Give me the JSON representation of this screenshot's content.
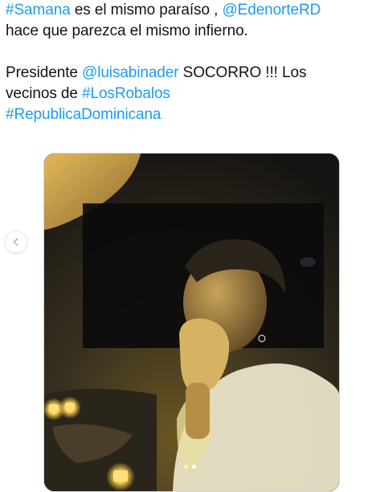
{
  "tweet": {
    "line1": {
      "hashtag": "#Samana",
      "text": " es el mismo paraíso , ",
      "mention": "@EdenorteRD"
    },
    "line2": "hace que parezca el mismo infierno.",
    "line3": {
      "text_before": "Presidente ",
      "mention": "@luisabinader",
      "text_after": " SOCORRO !!! Los"
    },
    "line4": {
      "text_before": "vecinos de ",
      "hashtag": "#LosRobalos"
    },
    "line5": {
      "hashtag": "#RepublicaDominicana"
    }
  },
  "media": {
    "icon": "photo",
    "carousel": {
      "prev_icon": "chevron-left-icon",
      "total": 2,
      "active_index": 2
    }
  },
  "colors": {
    "link": "#1d9bf0",
    "text": "#0f1419",
    "candle": "#ffd45a"
  }
}
